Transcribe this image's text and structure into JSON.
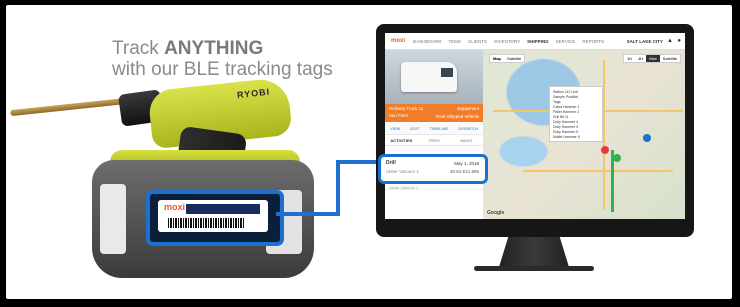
{
  "headline": {
    "line1_prefix": "Track ",
    "line1_bold": "ANYTHING",
    "line2": "with our BLE tracking tags"
  },
  "drill": {
    "brand": "RYOBI"
  },
  "tag": {
    "logo": "moxi"
  },
  "app": {
    "logo": "moxi",
    "nav": [
      "DASHBOARD",
      "TEMS",
      "CLIENTS",
      "INVENTORY",
      "SHIPPING",
      "SERVICE",
      "REPORTS"
    ],
    "active_nav": "SHIPPING",
    "city": "SALT LAKE CITY",
    "vehicle": {
      "name": "Delivery Truck 11",
      "sub": "Van Fleet",
      "category": "Equipment",
      "category2": "Fleet Shipped Vehicle"
    },
    "actions": [
      "VIEW",
      "EDIT",
      "TIMELINE",
      "DISPATCH"
    ],
    "tabs": [
      "ACTIVITIES",
      "TRIPS",
      "MAINT"
    ],
    "list_rows": [
      {
        "title": "Drill Bit",
        "sub": "Ulster Vacuum 1",
        "time": "May 1, 2018"
      }
    ],
    "map_type": [
      "Map",
      "Satellite"
    ],
    "time_range": [
      "1H",
      "4H",
      "Max",
      "Satellite"
    ],
    "popup_lines": [
      "Station 112 Unit",
      "Sample Position",
      "Tags:",
      "Galva Hammer 1",
      "Pallet Hammer 2",
      "Drill Bit 11",
      "Dolly Hammer 4",
      "Dolly Hammer 4",
      "Dolly Hammer 5",
      "Mallet Hammer 6"
    ],
    "google": "Google"
  },
  "callout": {
    "title": "Drill",
    "date": "May 1, 2018",
    "sub": "Ulster Vacuum 1",
    "coords": "40.64 E11.996"
  }
}
